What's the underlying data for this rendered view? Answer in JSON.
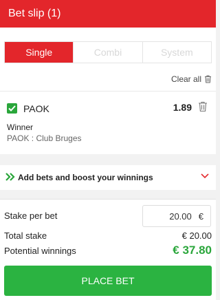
{
  "header": {
    "title": "Bet slip (1)"
  },
  "tabs": [
    {
      "label": "Single",
      "active": true
    },
    {
      "label": "Combi",
      "active": false
    },
    {
      "label": "System",
      "active": false
    }
  ],
  "clear_all": {
    "label": "Clear all",
    "icon": "trash-icon"
  },
  "bet": {
    "team": "PAOK",
    "odds": "1.89",
    "market": "Winner",
    "event": "PAOK : Club Bruges",
    "checked": true
  },
  "boost": {
    "label": "Add bets and boost your winnings"
  },
  "stake": {
    "label": "Stake per bet",
    "value": "20.00",
    "currency": "€",
    "total_label": "Total stake",
    "total_value": "€ 20.00",
    "winnings_label": "Potential winnings",
    "winnings_value": "€ 37.80"
  },
  "place_bet": {
    "label": "PLACE BET"
  },
  "colors": {
    "brand_red": "#e3262b",
    "green": "#2aa63b",
    "button_green": "#2bb341"
  }
}
